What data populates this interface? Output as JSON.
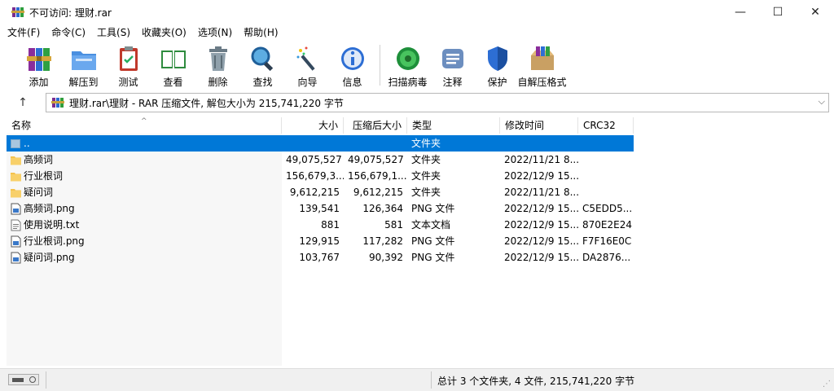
{
  "window": {
    "title": "不可访问: 理财.rar",
    "minimize": "—",
    "maximize": "☐",
    "close": "✕"
  },
  "menu": [
    "文件(F)",
    "命令(C)",
    "工具(S)",
    "收藏夹(O)",
    "选项(N)",
    "帮助(H)"
  ],
  "toolbar": {
    "add": "添加",
    "extract_to": "解压到",
    "test": "测试",
    "view": "查看",
    "delete": "删除",
    "find": "查找",
    "wizard": "向导",
    "info": "信息",
    "virus_scan": "扫描病毒",
    "comment": "注释",
    "protect": "保护",
    "sfx": "自解压格式"
  },
  "address": {
    "up": "↑",
    "path": "理财.rar\\理财 - RAR 压缩文件, 解包大小为 215,741,220 字节",
    "dropdown": "⌵"
  },
  "columns": {
    "name": "名称",
    "size": "大小",
    "packed": "压缩后大小",
    "type": "类型",
    "modified": "修改时间",
    "crc": "CRC32"
  },
  "rows": [
    {
      "name": "..",
      "size": "",
      "packed": "",
      "type": "文件夹",
      "modified": "",
      "crc": "",
      "icon": "parent-folder-icon",
      "selected": true
    },
    {
      "name": "高频词",
      "size": "49,075,527",
      "packed": "49,075,527",
      "type": "文件夹",
      "modified": "2022/11/21 8...",
      "crc": "",
      "icon": "folder-icon"
    },
    {
      "name": "行业根词",
      "size": "156,679,3...",
      "packed": "156,679,1...",
      "type": "文件夹",
      "modified": "2022/12/9 15...",
      "crc": "",
      "icon": "folder-icon"
    },
    {
      "name": "疑问词",
      "size": "9,612,215",
      "packed": "9,612,215",
      "type": "文件夹",
      "modified": "2022/11/21 8...",
      "crc": "",
      "icon": "folder-icon"
    },
    {
      "name": "高频词.png",
      "size": "139,541",
      "packed": "126,364",
      "type": "PNG 文件",
      "modified": "2022/12/9 15...",
      "crc": "C5EDD5...",
      "icon": "image-file-icon"
    },
    {
      "name": "使用说明.txt",
      "size": "881",
      "packed": "581",
      "type": "文本文档",
      "modified": "2022/12/9 15...",
      "crc": "870E2E24",
      "icon": "text-file-icon"
    },
    {
      "name": "行业根词.png",
      "size": "129,915",
      "packed": "117,282",
      "type": "PNG 文件",
      "modified": "2022/12/9 15...",
      "crc": "F7F16E0C",
      "icon": "image-file-icon"
    },
    {
      "name": "疑问词.png",
      "size": "103,767",
      "packed": "90,392",
      "type": "PNG 文件",
      "modified": "2022/12/9 15...",
      "crc": "DA2876...",
      "icon": "image-file-icon"
    }
  ],
  "status": {
    "summary": "总计 3 个文件夹, 4 文件, 215,741,220 字节"
  },
  "colors": {
    "selection": "#0078d7",
    "folder": "#f4c24d"
  }
}
